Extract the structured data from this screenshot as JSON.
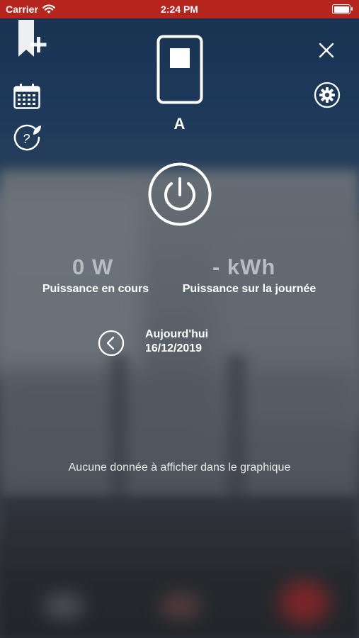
{
  "status_bar": {
    "carrier": "Carrier",
    "time": "2:24 PM",
    "battery_level": 1.0
  },
  "colors": {
    "status_bar": "#b7251f",
    "text": "#ffffff",
    "metric_value": "#b9bcc0"
  },
  "toolbar": {
    "bookmark_icon": "bookmark-add-icon",
    "calendar_icon": "calendar-icon",
    "help_icon": "eco-help-icon",
    "close_icon": "close-icon",
    "settings_icon": "gear-icon"
  },
  "device": {
    "icon": "switch-device-icon",
    "name": "A"
  },
  "power_button_icon": "power-icon",
  "metrics": {
    "current": {
      "value": "0 W",
      "label": "Puissance en cours"
    },
    "daily": {
      "value": "- kWh",
      "label": "Puissance sur la journée"
    }
  },
  "date_nav": {
    "prev_icon": "chevron-left-circle-icon",
    "day": "Aujourd'hui",
    "date": "16/12/2019"
  },
  "chart": {
    "empty_message": "Aucune donnée à afficher dans le graphique"
  }
}
